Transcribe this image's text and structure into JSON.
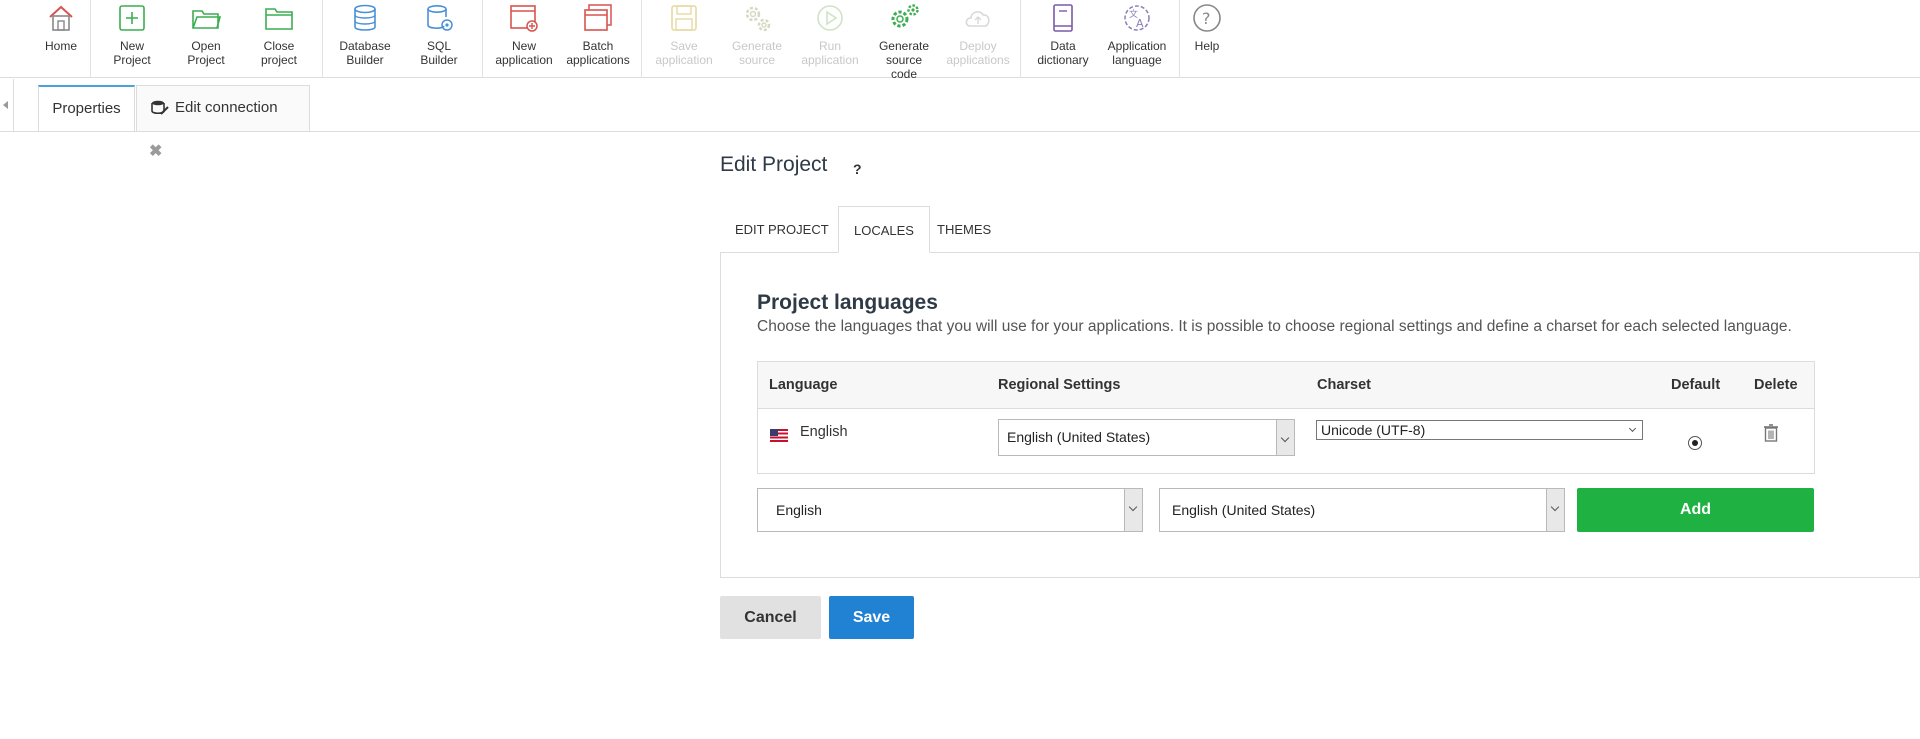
{
  "toolbar": {
    "items": [
      {
        "label": "Home",
        "icon": "home-icon"
      },
      {
        "label": "New\nProject",
        "icon": "new-project-icon"
      },
      {
        "label": "Open\nProject",
        "icon": "open-folder-icon"
      },
      {
        "label": "Close\nproject",
        "icon": "close-folder-icon"
      },
      {
        "label": "Database\nBuilder",
        "icon": "database-icon"
      },
      {
        "label": "SQL\nBuilder",
        "icon": "sql-database-icon"
      },
      {
        "label": "New\napplication",
        "icon": "new-application-icon"
      },
      {
        "label": "Batch\napplications",
        "icon": "batch-applications-icon"
      },
      {
        "label": "Save\napplication",
        "icon": "save-icon",
        "disabled": true
      },
      {
        "label": "Generate\nsource",
        "icon": "gears-icon",
        "disabled": true
      },
      {
        "label": "Run\napplication",
        "icon": "play-icon",
        "disabled": true
      },
      {
        "label": "Generate\nsource\ncode",
        "icon": "gears-code-icon"
      },
      {
        "label": "Deploy\napplications",
        "icon": "cloud-upload-icon",
        "disabled": true
      },
      {
        "label": "Data\ndictionary",
        "icon": "book-icon"
      },
      {
        "label": "Application\nlanguage",
        "icon": "translate-icon"
      },
      {
        "label": "Help",
        "icon": "help-icon"
      }
    ]
  },
  "doc_tabs": {
    "properties": "Properties",
    "edit_connection": "Edit connection"
  },
  "page": {
    "title": "Edit Project",
    "help": "?",
    "tabs": [
      "EDIT PROJECT",
      "LOCALES",
      "THEMES"
    ],
    "active_tab": "LOCALES"
  },
  "section": {
    "title": "Project languages",
    "description": "Choose the languages that you will use for your applications. It is possible to choose regional settings and define a charset for each selected language."
  },
  "table": {
    "headers": {
      "language": "Language",
      "regional": "Regional Settings",
      "charset": "Charset",
      "default": "Default",
      "delete": "Delete"
    },
    "rows": [
      {
        "language": "English",
        "regional": "English (United States)",
        "charset": "Unicode (UTF-8)",
        "default": true
      }
    ]
  },
  "add_row": {
    "language": "English",
    "regional": "English (United States)",
    "add_label": "Add"
  },
  "buttons": {
    "cancel": "Cancel",
    "save": "Save"
  },
  "colors": {
    "accent_green": "#1fb141",
    "accent_blue": "#2181d2",
    "active_tab_border": "#4aa3df"
  }
}
